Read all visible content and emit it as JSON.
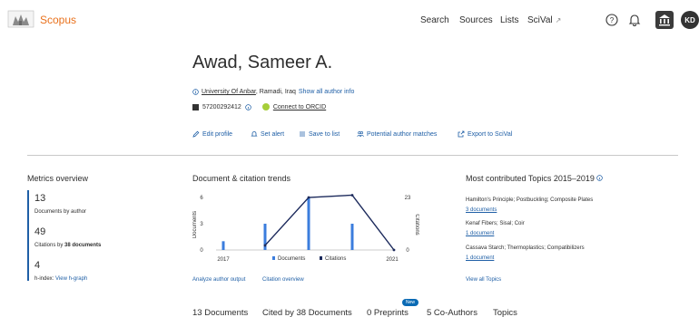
{
  "header": {
    "brand": "Scopus",
    "nav": [
      "Search",
      "Sources",
      "Lists",
      "SciVal"
    ],
    "scival_ext": "↗",
    "avatar_initials": "KD"
  },
  "author": {
    "name": "Awad, Sameer A.",
    "affiliation_link": "University Of Anbar",
    "affiliation_rest": ", Ramadi, Iraq",
    "show_all": "Show all author info",
    "author_id": "57200292412",
    "orcid_label": "Connect to ORCID"
  },
  "actions": [
    "Edit profile",
    "Set alert",
    "Save to list",
    "Potential author matches",
    "Export to SciVal"
  ],
  "metrics": {
    "title": "Metrics overview",
    "documents_value": "13",
    "documents_label": "Documents by author",
    "citations_value": "49",
    "citations_prefix": "Citations by",
    "citations_bold": "38 documents",
    "hindex_value": "4",
    "hindex_label": "h-index:",
    "hindex_link": "View h-graph"
  },
  "trends": {
    "title": "Document & citation trends",
    "link_analyze": "Analyze author output",
    "link_citation": "Citation overview"
  },
  "chart_data": {
    "type": "bar",
    "x_start_label": "2017",
    "x_end_label": "2021",
    "left_axis_label": "Documents",
    "right_axis_label": "Citations",
    "left_ticks": [
      "6",
      "3",
      "0"
    ],
    "right_ticks": [
      "23",
      "0"
    ],
    "left_max": 6,
    "right_max": 23,
    "series": [
      {
        "name": "Documents",
        "values": [
          1,
          3,
          6,
          3,
          0
        ]
      },
      {
        "name": "Citations",
        "values": [
          0,
          0,
          2,
          23,
          24,
          0
        ]
      }
    ],
    "colors": {
      "documents": "#3b7ddd",
      "citations": "#1c2a5c"
    }
  },
  "topics": {
    "title": "Most contributed Topics 2015–2019",
    "items": [
      {
        "name": "Hamilton's Principle; Postbuckling; Composite Plates",
        "docs": "3 documents"
      },
      {
        "name": "Kenaf Fibers; Sisal; Coir",
        "docs": "1 document"
      },
      {
        "name": "Cassava Starch; Thermoplastics; Compatibilizers",
        "docs": "1 document"
      }
    ],
    "view_all": "View all Topics"
  },
  "tabs": [
    "13 Documents",
    "Cited by 38 Documents",
    "0 Preprints",
    "5 Co-Authors",
    "Topics"
  ],
  "new_badge": "New"
}
